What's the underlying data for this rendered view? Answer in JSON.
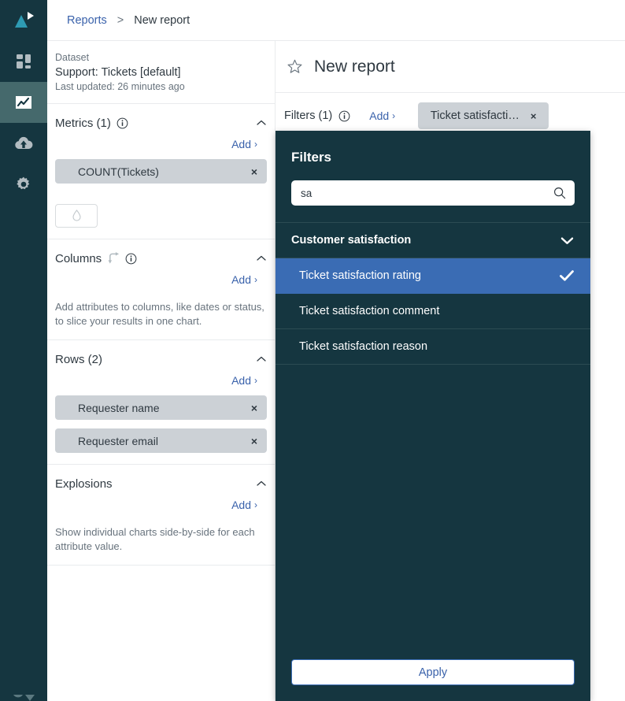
{
  "rail": {
    "logo_name": "product-logo",
    "items": [
      {
        "name": "dashboards",
        "icon": "grid-icon"
      },
      {
        "name": "reports",
        "icon": "chart-line-icon",
        "active": true
      },
      {
        "name": "data-imports",
        "icon": "cloud-upload-icon"
      },
      {
        "name": "settings",
        "icon": "gear-icon"
      }
    ],
    "bottom_icon": "user-avatar-icon"
  },
  "breadcrumb": {
    "root_label": "Reports",
    "separator": ">",
    "current_label": "New report"
  },
  "config": {
    "dataset": {
      "label": "Dataset",
      "name": "Support: Tickets [default]",
      "updated": "Last updated: 26 minutes ago"
    },
    "sections": [
      {
        "key": "metrics",
        "title": "Metrics (1)",
        "has_info": true,
        "has_swap": false,
        "add_label": "Add",
        "add_caret": "›",
        "chips": [
          {
            "label": "COUNT(Tickets)",
            "remove": "×"
          }
        ],
        "hint": "",
        "has_droplet": true
      },
      {
        "key": "columns",
        "title": "Columns",
        "has_info": true,
        "has_swap": true,
        "add_label": "Add",
        "add_caret": "›",
        "chips": [],
        "hint": "Add attributes to columns, like dates or status, to slice your results in one chart.",
        "has_droplet": false
      },
      {
        "key": "rows",
        "title": "Rows (2)",
        "has_info": false,
        "has_swap": false,
        "add_label": "Add",
        "add_caret": "›",
        "chips": [
          {
            "label": "Requester name",
            "remove": "×"
          },
          {
            "label": "Requester email",
            "remove": "×"
          }
        ],
        "hint": "",
        "has_droplet": false
      },
      {
        "key": "explosions",
        "title": "Explosions",
        "has_info": false,
        "has_swap": false,
        "add_label": "Add",
        "add_caret": "›",
        "chips": [],
        "hint": "Show individual charts side-by-side for each attribute value.",
        "has_droplet": false
      }
    ]
  },
  "report": {
    "title": "New report",
    "star_icon": "star-outline-icon",
    "filters": {
      "label": "Filters (1)",
      "info_icon": "info-icon",
      "add_label": "Add",
      "add_caret": "›",
      "chip": {
        "label": "Ticket satisfacti…",
        "remove": "×"
      }
    }
  },
  "filter_panel": {
    "heading": "Filters",
    "search": {
      "value": "sa",
      "placeholder": "Search",
      "icon": "search-icon"
    },
    "group": {
      "label": "Customer satisfaction",
      "chevron_icon": "chevron-down-icon"
    },
    "options": [
      {
        "label": "Ticket satisfaction rating",
        "selected": true,
        "check_icon": "check-icon"
      },
      {
        "label": "Ticket satisfaction comment",
        "selected": false
      },
      {
        "label": "Ticket satisfaction reason",
        "selected": false
      }
    ],
    "apply_label": "Apply"
  },
  "colors": {
    "rail_bg": "#153640",
    "rail_active": "#45696c",
    "logo_teal": "#2e9bb3",
    "link_blue": "#3a62ab",
    "panel_bg": "#153640",
    "option_selected": "#3a6cb4",
    "chip_bg": "#ccd1d6",
    "text": "#2f3941",
    "muted_text": "#68737d",
    "border": "#e9ebed"
  }
}
